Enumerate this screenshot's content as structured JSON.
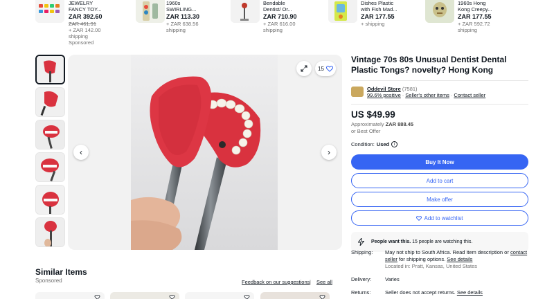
{
  "recommendations": [
    {
      "title_lines": [
        "JEWELRY",
        "FANCY TOY..."
      ],
      "price": "ZAR 392.60",
      "sub": [
        "ZAR 461.91",
        "+ ZAR 142.00",
        "shipping",
        "Sponsored"
      ],
      "strike_index": 0
    },
    {
      "title_lines": [
        "1960s",
        "SWIRLING..."
      ],
      "price": "ZAR 113.30",
      "sub": [
        "+ ZAR 638.56",
        "shipping"
      ],
      "strike_index": -1
    },
    {
      "title_lines": [
        "Bendable",
        "Dentist/ Or..."
      ],
      "price": "ZAR 710.90",
      "sub": [
        "+ ZAR 616.00",
        "shipping"
      ],
      "strike_index": -1
    },
    {
      "title_lines": [
        "Dishes Plastic",
        "with Fish Mad..."
      ],
      "price": "ZAR 177.55",
      "sub": [
        "+ shipping"
      ],
      "strike_index": -1
    },
    {
      "title_lines": [
        "1960s Hong",
        "Kong Creepy..."
      ],
      "price": "ZAR 177.55",
      "sub": [
        "+ ZAR 592.72",
        "shipping"
      ],
      "strike_index": -1
    }
  ],
  "gallery": {
    "watch_count": "15",
    "icons": {
      "expand": "expand-icon",
      "heart": "heart-icon",
      "prev": "chevron-left-icon",
      "next": "chevron-right-icon"
    }
  },
  "item": {
    "title": "Vintage 70s 80s Unusual Dentist Dental Plastic Tongs? novelty? Hong Kong",
    "seller_name": "Oddevil Store",
    "seller_count": "(7581)",
    "seller_feedback": "99.6% positive",
    "seller_other_items": "Seller's other items",
    "contact_seller": "Contact seller",
    "price": "US $49.99",
    "approx_prefix": "Approximately",
    "approx_value": "ZAR 888.45",
    "best_offer": "or Best Offer",
    "condition_label": "Condition:",
    "condition_value": "Used",
    "buy_now": "Buy It Now",
    "add_to_cart": "Add to cart",
    "make_offer": "Make offer",
    "add_to_watchlist": "Add to watchlist",
    "people_bold": "People want this.",
    "people_text": "15 people are watching this."
  },
  "details": {
    "shipping_label": "Shipping:",
    "shipping_text": "May not ship to South Africa. Read item description or",
    "shipping_link1": "contact seller",
    "shipping_text2": "for shipping options.",
    "shipping_link2": "See details",
    "location": "Located in: Pratt, Kansas, United States",
    "delivery_label": "Delivery:",
    "delivery_value": "Varies",
    "returns_label": "Returns:",
    "returns_text": "Seller does not accept returns.",
    "returns_link": "See details"
  },
  "similar": {
    "title": "Similar Items",
    "sponsored": "Sponsored",
    "feedback": "Feedback on our suggestions",
    "separator": "|",
    "see_all": "See all"
  },
  "colors": {
    "accent": "#3665f3",
    "text": "#111820",
    "muted": "#707070",
    "product_red": "#d9323f"
  }
}
